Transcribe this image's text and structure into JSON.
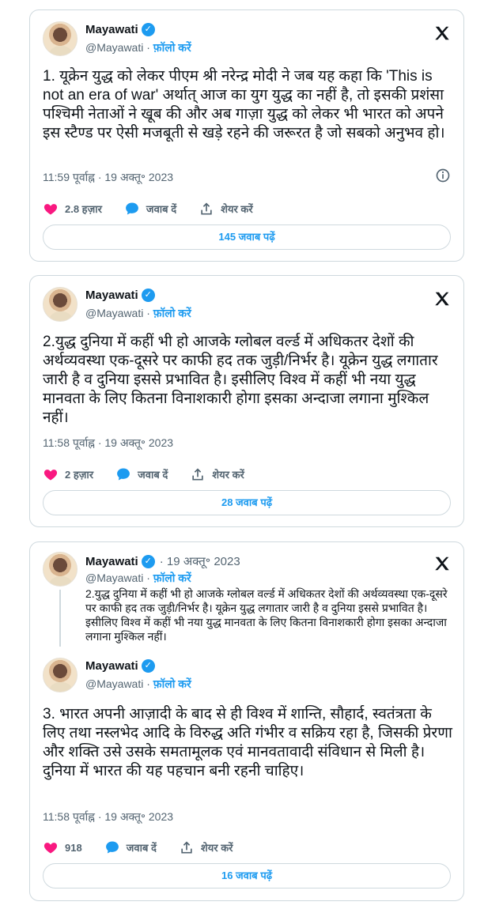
{
  "tweets": [
    {
      "author": "Mayawati",
      "handle": "@Mayawati",
      "follow": "फ़ॉलो करें",
      "text": "1. यूक्रेन युद्ध को लेकर पीएम श्री नरेन्द्र मोदी ने जब यह कहा कि 'This is not an era of war' अर्थात् आज का युग युद्ध का नहीं है, तो इसकी प्रशंसा पश्चिमी नेताओं ने खूब की और अब गाज़ा युद्ध को लेकर भी भारत को अपने इस स्टैण्ड पर ऐसी मजबूती से खड़े रहने की जरूरत है जो सबको अनुभव हो।",
      "timestamp": "11:59 पूर्वाह्न · 19 अक्तू॰ 2023",
      "likes": "2.8 हज़ार",
      "reply_label": "जवाब दें",
      "share_label": "शेयर करें",
      "replies_button": "145 जवाब पढ़ें"
    },
    {
      "author": "Mayawati",
      "handle": "@Mayawati",
      "follow": "फ़ॉलो करें",
      "text": "2.युद्ध दुनिया में कहीं भी हो आजके ग्लोबल वर्ल्ड में अधिकतर देशों की अर्थव्यवस्था एक-दूसरे पर काफी हद तक जुड़ी/निर्भर है। यूक्रेन युद्ध लगातार जारी है व दुनिया इससे प्रभावित है। इसीलिए विश्व में कहीं भी नया युद्ध मानवता के लिए कितना विनाशकारी होगा इसका अन्दाजा लगाना मुश्किल नहीं।",
      "timestamp": "11:58 पूर्वाह्न · 19 अक्तू॰ 2023",
      "likes": "2 हज़ार",
      "reply_label": "जवाब दें",
      "share_label": "शेयर करें",
      "replies_button": "28 जवाब पढ़ें"
    },
    {
      "quoted": {
        "author": "Mayawati",
        "date": "· 19 अक्तू॰ 2023",
        "handle": "@Mayawati",
        "follow": "फ़ॉलो करें",
        "text": "2.युद्ध दुनिया में कहीं भी हो आजके ग्लोबल वर्ल्ड में अधिकतर देशों की अर्थव्यवस्था एक-दूसरे पर काफी हद तक जुड़ी/निर्भर है। यूक्रेन युद्ध लगातार जारी है व दुनिया इससे प्रभावित है। इसीलिए विश्व में कहीं भी नया युद्ध मानवता के लिए कितना विनाशकारी होगा इसका अन्दाजा लगाना मुश्किल नहीं।"
      },
      "author": "Mayawati",
      "handle": "@Mayawati",
      "follow": "फ़ॉलो करें",
      "text": "3. भारत अपनी आज़ादी के बाद से ही विश्व में शान्ति, सौहार्द, स्वतंत्रता के लिए तथा नस्लभेद आदि के विरुद्ध अति गंभीर व सक्रिय रहा है, जिसकी प्रेरणा और शक्ति उसे उसके समतामूलक एवं मानवतावादी संविधान से मिली है। दुनिया में भारत की यह पहचान बनी रहनी चाहिए।",
      "timestamp": "11:58 पूर्वाह्न · 19 अक्तू॰ 2023",
      "likes": "918",
      "reply_label": "जवाब दें",
      "share_label": "शेयर करें",
      "replies_button": "16 जवाब पढ़ें"
    }
  ],
  "colors": {
    "accent": "#1d9bf0",
    "like": "#f91880",
    "muted": "#536471",
    "border": "#cfd9de"
  },
  "icons": {
    "logo": "x-logo-icon",
    "verified": "verified-badge-icon",
    "like": "heart-icon",
    "reply": "reply-bubble-icon",
    "share": "share-upload-icon",
    "info": "info-icon"
  }
}
